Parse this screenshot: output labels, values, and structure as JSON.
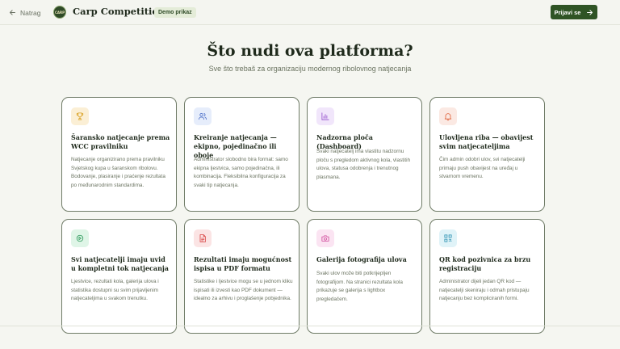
{
  "header": {
    "back_label": "Natrag",
    "logo_text": "CARP",
    "brand": "Carp Competitions",
    "demo_badge": "Demo prikaz",
    "login_label": "Prijavi se"
  },
  "hero": {
    "title": "Što nudi ova platforma?",
    "subtitle": "Sve što trebaš za organizaciju modernog ribolovnog natjecanja"
  },
  "features": [
    {
      "icon": "trophy-icon",
      "color": "#fbefd5",
      "stroke": "#d9a021",
      "title": "Šaransko natjecanje prema WCC pravilniku",
      "desc": "Natjecanje organizirano prema pravilniku Svjetskog kupa u šaranskom ribolovu. Bodovanje, plasiranje i praćenje rezultata po međunarodnim standardima."
    },
    {
      "icon": "users-icon",
      "color": "#e6edfb",
      "stroke": "#4c6fc9",
      "title": "Kreiranje natjecanja — ekipno, pojedinačno ili oboje",
      "desc": "Administrator slobodno bira format: samo ekipna ljestvica, samo pojedinačna, ili kombinacija. Fleksibilna konfiguracija za svaki tip natjecanja."
    },
    {
      "icon": "bar-chart-icon",
      "color": "#f1e6fb",
      "stroke": "#9b5ccf",
      "title": "Nadzorna ploča (Dashboard)",
      "desc": "Svaki natjecatelj ima vlastitu nadzornu ploču s pregledom aktivnog kola, vlastitih ulova, statusa odobrenja i trenutnog plasmana."
    },
    {
      "icon": "bell-icon",
      "color": "#fbe9e3",
      "stroke": "#e0653e",
      "title": "Ulovljena riba — obavijest svim natjecateljima",
      "desc": "Čim admin odobri ulov, svi natjecatelji primaju push obavijest na uređaj u stvarnom vremenu."
    },
    {
      "icon": "live-view-icon",
      "color": "#dff5e7",
      "stroke": "#2e9a5c",
      "title": "Svi natjecatelji imaju uvid u kompletni tok natjecanja",
      "desc": "Ljestvice, rezultati kola, galerija ulova i statistika dostupni su svim prijavljenim natjecateljima u svakom trenutku."
    },
    {
      "icon": "document-icon",
      "color": "#fbe4e4",
      "stroke": "#d94646",
      "title": "Rezultati imaju mogućnost ispisa u PDF formatu",
      "desc": "Statistike i ljestvice mogu se u jednom kliku ispisati ili izvesti kao PDF dokument — idealno za arhivu i proglašenje pobjednika."
    },
    {
      "icon": "camera-icon",
      "color": "#fbe4f2",
      "stroke": "#d0489a",
      "title": "Galerija fotografija ulova",
      "desc": "Svaki ulov može biti potkrijepljen fotografijom. Na stranici rezultata kola prikazuje se galerija s lightbox pregledačem."
    },
    {
      "icon": "qr-code-icon",
      "color": "#e0f3f8",
      "stroke": "#2f93b3",
      "title": "QR kod pozivnica za brzu registraciju",
      "desc": "Administrator dijeli jedan QR kod — natjecatelji skeniraju i odmah pristupaju natjecanju bez kompliciranih formi."
    }
  ]
}
